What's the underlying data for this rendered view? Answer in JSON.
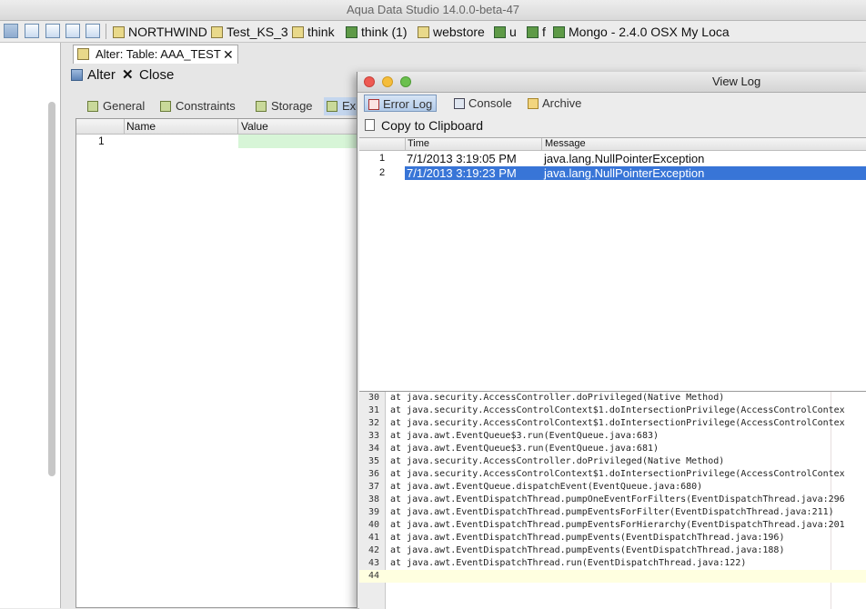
{
  "app": {
    "title": "Aqua Data Studio 14.0.0-beta-47"
  },
  "toolbar": {
    "connections": [
      {
        "label": "NORTHWIND",
        "icon": "database-icon"
      },
      {
        "label": "Test_KS_3",
        "icon": "database-icon"
      },
      {
        "label": "think",
        "icon": "database-icon"
      },
      {
        "label": "think (1)",
        "icon": "server-icon"
      },
      {
        "label": "webstore",
        "icon": "database-icon"
      },
      {
        "label": "u",
        "icon": "server-icon"
      },
      {
        "label": "f",
        "icon": "server-icon"
      },
      {
        "label": "Mongo - 2.4.0 OSX My Loca",
        "icon": "server-icon"
      }
    ]
  },
  "doc_tab": {
    "label": "Alter: Table: AAA_TEST",
    "close": "✕"
  },
  "alter_bar": {
    "alter_label": "Alter",
    "close_glyph": "✕",
    "close_label": "Close"
  },
  "sub_tabs": [
    "General",
    "Constraints",
    "Storage",
    "Ex"
  ],
  "grid": {
    "headers": [
      "Name",
      "Value"
    ],
    "rows": [
      {
        "num": "1",
        "name": "",
        "value": ""
      }
    ]
  },
  "view_log": {
    "title": "View Log",
    "tabs": [
      "Error Log",
      "Console",
      "Archive"
    ],
    "copy_label": "Copy to Clipboard",
    "headers": [
      "Time",
      "Message"
    ],
    "rows": [
      {
        "num": "1",
        "time": "7/1/2013 3:19:05 PM",
        "message": "java.lang.NullPointerException"
      },
      {
        "num": "2",
        "time": "7/1/2013 3:19:23 PM",
        "message": "java.lang.NullPointerException"
      }
    ],
    "stack": [
      {
        "n": "30",
        "t": "at java.security.AccessController.doPrivileged(Native Method)"
      },
      {
        "n": "31",
        "t": "at java.security.AccessControlContext$1.doIntersectionPrivilege(AccessControlContex"
      },
      {
        "n": "32",
        "t": "at java.security.AccessControlContext$1.doIntersectionPrivilege(AccessControlContex"
      },
      {
        "n": "33",
        "t": "at java.awt.EventQueue$3.run(EventQueue.java:683)"
      },
      {
        "n": "34",
        "t": "at java.awt.EventQueue$3.run(EventQueue.java:681)"
      },
      {
        "n": "35",
        "t": "at java.security.AccessController.doPrivileged(Native Method)"
      },
      {
        "n": "36",
        "t": "at java.security.AccessControlContext$1.doIntersectionPrivilege(AccessControlContex"
      },
      {
        "n": "37",
        "t": "at java.awt.EventQueue.dispatchEvent(EventQueue.java:680)"
      },
      {
        "n": "38",
        "t": "at java.awt.EventDispatchThread.pumpOneEventForFilters(EventDispatchThread.java:296"
      },
      {
        "n": "39",
        "t": "at java.awt.EventDispatchThread.pumpEventsForFilter(EventDispatchThread.java:211)"
      },
      {
        "n": "40",
        "t": "at java.awt.EventDispatchThread.pumpEventsForHierarchy(EventDispatchThread.java:201"
      },
      {
        "n": "41",
        "t": "at java.awt.EventDispatchThread.pumpEvents(EventDispatchThread.java:196)"
      },
      {
        "n": "42",
        "t": "at java.awt.EventDispatchThread.pumpEvents(EventDispatchThread.java:188)"
      },
      {
        "n": "43",
        "t": "at java.awt.EventDispatchThread.run(EventDispatchThread.java:122)"
      },
      {
        "n": "44",
        "t": ""
      }
    ]
  },
  "colors": {
    "selection": "#3875d7",
    "tab_selected": "#b2cbe9",
    "value_cell": "#d7f5d7"
  }
}
